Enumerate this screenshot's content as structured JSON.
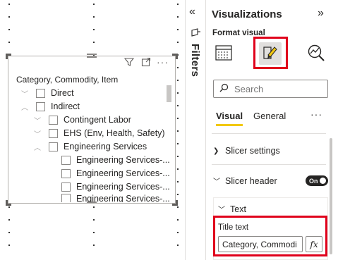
{
  "slicer": {
    "title": "Category, Commodity, Item",
    "items": [
      {
        "label": "Direct",
        "expanded": false
      },
      {
        "label": "Indirect",
        "expanded": true
      },
      {
        "label": "Contingent Labor",
        "expanded": false
      },
      {
        "label": "EHS (Env, Health, Safety)",
        "expanded": false
      },
      {
        "label": "Engineering Services",
        "expanded": true
      },
      {
        "label": "Engineering Services-..."
      },
      {
        "label": "Engineering Services-..."
      },
      {
        "label": "Engineering Services-..."
      },
      {
        "label": "Engineering Services-..."
      }
    ]
  },
  "filters": {
    "label": "Filters"
  },
  "viz": {
    "title": "Visualizations",
    "format_visual": "Format visual",
    "search_placeholder": "Search",
    "tabs": {
      "visual": "Visual",
      "general": "General"
    },
    "more": "···",
    "sections": {
      "slicer_settings": "Slicer settings",
      "slicer_header": "Slicer header",
      "text": "Text"
    },
    "toggle_label": "On",
    "title_text_label": "Title text",
    "title_text_value": "Category, Commodi",
    "fx_label": "fx"
  },
  "colors": {
    "highlight": "#e0001b",
    "tab_accent": "#f2c811"
  }
}
